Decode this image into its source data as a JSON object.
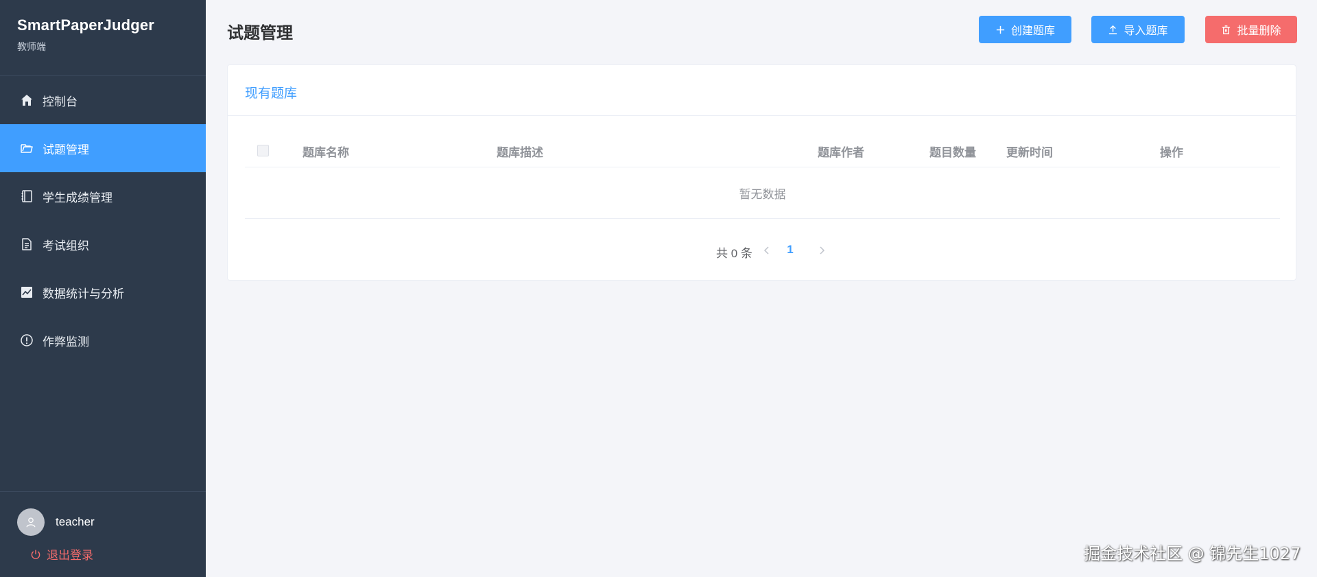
{
  "brand": {
    "title": "SmartPaperJudger",
    "subtitle": "教师端"
  },
  "sidebar": {
    "items": [
      {
        "label": "控制台",
        "icon": "home-icon",
        "active": false
      },
      {
        "label": "试题管理",
        "icon": "folder-open-icon",
        "active": true
      },
      {
        "label": "学生成绩管理",
        "icon": "notebook-icon",
        "active": false
      },
      {
        "label": "考试组织",
        "icon": "document-icon",
        "active": false
      },
      {
        "label": "数据统计与分析",
        "icon": "chart-icon",
        "active": false
      },
      {
        "label": "作弊监测",
        "icon": "warning-circle-icon",
        "active": false
      }
    ],
    "user": {
      "name": "teacher"
    },
    "logout_label": "退出登录"
  },
  "header": {
    "title": "试题管理",
    "buttons": {
      "create": "创建题库",
      "import": "导入题库",
      "delete": "批量删除"
    }
  },
  "card": {
    "title": "现有题库",
    "table": {
      "columns": [
        "题库名称",
        "题库描述",
        "题库作者",
        "题目数量",
        "更新时间",
        "操作"
      ],
      "rows": [],
      "empty_text": "暂无数据"
    },
    "pagination": {
      "total_text": "共 0 条",
      "current_page": "1"
    }
  },
  "watermark": "掘金技术社区 @ 锦先生1027",
  "colors": {
    "sidebar_bg": "#2d3a4b",
    "accent": "#409eff",
    "danger": "#f56c6c",
    "page_bg": "#f4f5f9"
  }
}
